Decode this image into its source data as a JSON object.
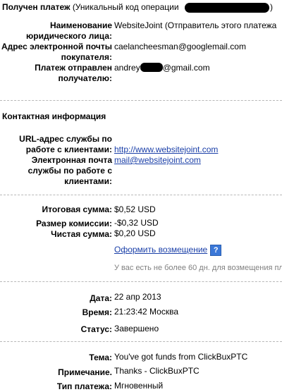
{
  "header": {
    "title": "Получен платеж",
    "operation_code_prefix": "(Уникальный код операции",
    "operation_code_suffix": ")"
  },
  "sender": {
    "company_label_1": "Наименование",
    "company_label_2": "юридического лица:",
    "company_value": "WebsiteJoint (Отправитель этого платежа",
    "email_label_1": "Адрес электронной почты",
    "email_label_2": "покупателя:",
    "email_value": "caelancheesman@googlemail.com",
    "recipient_label_1": "Платеж отправлен",
    "recipient_label_2": "получателю:",
    "recipient_prefix": "andrey",
    "recipient_suffix": "@gmail.com"
  },
  "contact": {
    "section_title": "Контактная информация",
    "url_label_1": "URL-адрес службы по",
    "url_label_2": "работе с клиентами:",
    "url_value": "http://www.websitejoint.com",
    "email_label_1": "Электронная почта",
    "email_label_2": "службы по работе с",
    "email_label_3": "клиентами:",
    "email_value": "mail@websitejoint.com"
  },
  "amounts": {
    "total_label": "Итоговая сумма:",
    "total_value": "$0,52 USD",
    "fee_label": "Размер комиссии:",
    "fee_value": "-$0,32 USD",
    "net_label": "Чистая сумма:",
    "net_value": "$0,20 USD",
    "refund_link": "Оформить возмещение",
    "help_icon": "?",
    "refund_note": "У вас есть не более 60 дн. для возмещения пл"
  },
  "details": {
    "date_label": "Дата:",
    "date_value": "22 апр 2013",
    "time_label": "Время:",
    "time_value": "21:23:42 Москва",
    "status_label": "Статус:",
    "status_value": "Завершено"
  },
  "message": {
    "subject_label": "Тема:",
    "subject_value": "You've got funds from ClickBuxPTC",
    "note_label": "Примечание.",
    "note_value": "Thanks - ClickBuxPTC",
    "type_label": "Тип платежа:",
    "type_value": "Мгновенный"
  }
}
